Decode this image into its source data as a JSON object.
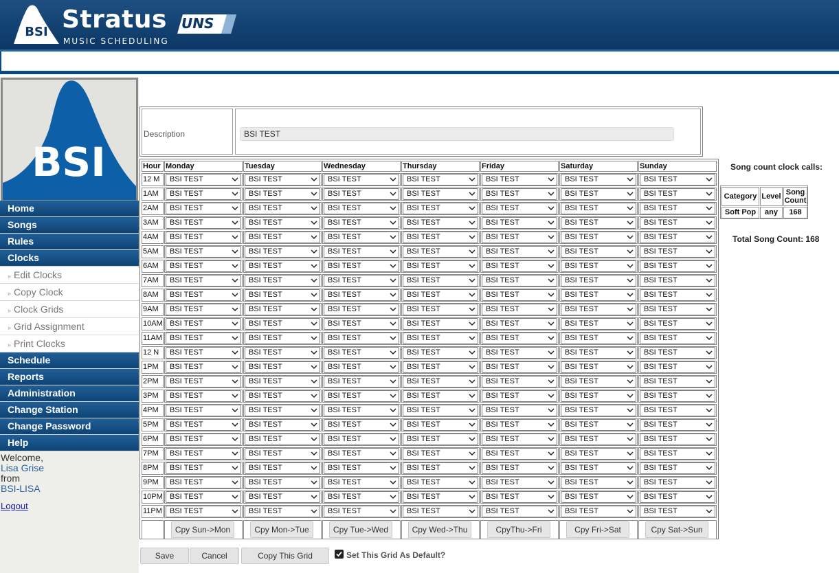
{
  "app": {
    "logo_mark": "BSI",
    "logo_name": "Stratus",
    "logo_badge": "UNS",
    "logo_subtitle": "MUSIC SCHEDULING",
    "side_logo_text": "BSI"
  },
  "sidebar": {
    "main_items": [
      {
        "label": "Home"
      },
      {
        "label": "Songs"
      },
      {
        "label": "Rules"
      },
      {
        "label": "Clocks"
      }
    ],
    "clock_sub_items": [
      {
        "label": "Edit Clocks"
      },
      {
        "label": "Copy Clock"
      },
      {
        "label": "Clock Grids"
      },
      {
        "label": "Grid Assignment"
      },
      {
        "label": "Print Clocks"
      }
    ],
    "lower_items": [
      {
        "label": "Schedule"
      },
      {
        "label": "Reports"
      },
      {
        "label": "Administration"
      },
      {
        "label": "Change Station"
      },
      {
        "label": "Change Password"
      },
      {
        "label": "Help"
      }
    ],
    "welcome_label": "Welcome,",
    "user_name": "Lisa Grise",
    "from_label": "from",
    "station": "BSI-LISA",
    "logout_label": "Logout"
  },
  "description": {
    "label": "Description",
    "value": "BSI TEST"
  },
  "grid": {
    "hour_header": "Hour",
    "days": [
      "Monday",
      "Tuesday",
      "Wednesday",
      "Thursday",
      "Friday",
      "Saturday",
      "Sunday"
    ],
    "hours": [
      "12 M",
      "1AM",
      "2AM",
      "3AM",
      "4AM",
      "5AM",
      "6AM",
      "7AM",
      "8AM",
      "9AM",
      "10AM",
      "11AM",
      "12 N",
      "1PM",
      "2PM",
      "3PM",
      "4PM",
      "5PM",
      "6PM",
      "7PM",
      "8PM",
      "9PM",
      "10PM",
      "11PM"
    ],
    "clock_value": "BSI TEST",
    "copy_buttons": [
      "Cpy Sun->Mon",
      "Cpy Mon->Tue",
      "Cpy Tue->Wed",
      "Cpy Wed->Thu",
      "CpyThu->Fri",
      "Cpy Fri->Sat",
      "Cpy Sat->Sun"
    ]
  },
  "actions": {
    "save": "Save",
    "cancel": "Cancel",
    "copy_grid": "Copy This Grid",
    "default_label": "Set This Grid As Default?",
    "default_checked": true
  },
  "song_count": {
    "title": "Song count clock calls:",
    "headers": [
      "Category",
      "Level",
      "Song Count"
    ],
    "rows": [
      {
        "category": "Soft Pop",
        "level": "any",
        "count": "168"
      }
    ],
    "total_label": "Total Song Count: 168"
  },
  "colors": {
    "header_blue": "#0b3766",
    "nav_blue": "#205f97",
    "link_blue": "#2a6097"
  }
}
